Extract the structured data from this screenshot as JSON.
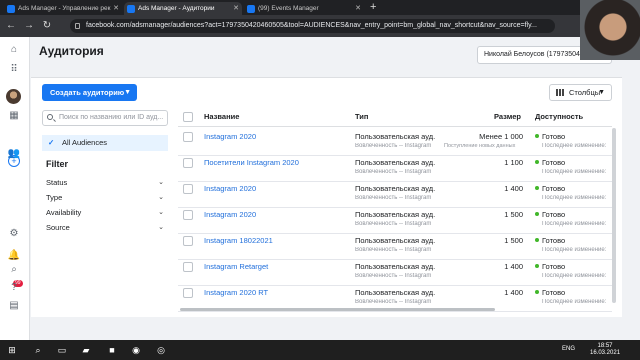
{
  "browser": {
    "tabs": [
      {
        "label": "Ads Manager - Управление рек"
      },
      {
        "label": "Ads Manager - Аудитории"
      },
      {
        "label": "(99) Events Manager"
      }
    ],
    "url": "facebook.com/adsmanager/audiences?act=1797350420460505&tool=AUDIENCES&nav_entry_point=bm_global_nav_shortcut&nav_source=fly..."
  },
  "header": {
    "title": "Аудитория",
    "account": "Николай Белоусов (17973504206"
  },
  "rail": {
    "notification_count": "99"
  },
  "toolbar": {
    "create_label": "Создать аудиторию",
    "columns_label": "Столбцы"
  },
  "sidebar": {
    "search_placeholder": "Поиск по названию или ID ауд...",
    "all_audiences": "All Audiences",
    "filter_title": "Filter",
    "filters": [
      "Status",
      "Type",
      "Availability",
      "Source"
    ]
  },
  "table": {
    "headers": {
      "name": "Название",
      "type": "Тип",
      "size": "Размер",
      "availability": "Доступность"
    },
    "rows": [
      {
        "name": "Instagram 2020",
        "type": "Пользовательская ауд...",
        "type_sub": "Вовлеченность -- Instagram",
        "size": "Менее 1 000",
        "size_sub": "Поступление новых данных",
        "status": "Готово",
        "status_sub": "Последнее изменение:"
      },
      {
        "name": "Посетители Instagram 2020",
        "type": "Пользовательская ауд...",
        "type_sub": "Вовлеченность -- Instagram",
        "size": "1 100",
        "size_sub": "",
        "status": "Готово",
        "status_sub": "Последнее изменение:"
      },
      {
        "name": "Instagram 2020",
        "type": "Пользовательская ауд...",
        "type_sub": "Вовлеченность -- Instagram",
        "size": "1 400",
        "size_sub": "",
        "status": "Готово",
        "status_sub": "Последнее изменение:"
      },
      {
        "name": "Instagram 2020",
        "type": "Пользовательская ауд...",
        "type_sub": "Вовлеченность -- Instagram",
        "size": "1 500",
        "size_sub": "",
        "status": "Готово",
        "status_sub": "Последнее изменение:"
      },
      {
        "name": "Instagram 18022021",
        "type": "Пользовательская ауд...",
        "type_sub": "Вовлеченность -- Instagram",
        "size": "1 500",
        "size_sub": "",
        "status": "Готово",
        "status_sub": "Последнее изменение:"
      },
      {
        "name": "Instagram Retarget",
        "type": "Пользовательская ауд...",
        "type_sub": "Вовлеченность -- Instagram",
        "size": "1 400",
        "size_sub": "",
        "status": "Готово",
        "status_sub": "Последнее изменение:"
      },
      {
        "name": "Instagram 2020 RT",
        "type": "Пользовательская ауд...",
        "type_sub": "Вовлеченность -- Instagram",
        "size": "1 400",
        "size_sub": "",
        "status": "Готово",
        "status_sub": "Последнее изменение:"
      }
    ]
  },
  "taskbar": {
    "lang": "ENG",
    "time": "18:57",
    "date": "16.03.2021"
  }
}
